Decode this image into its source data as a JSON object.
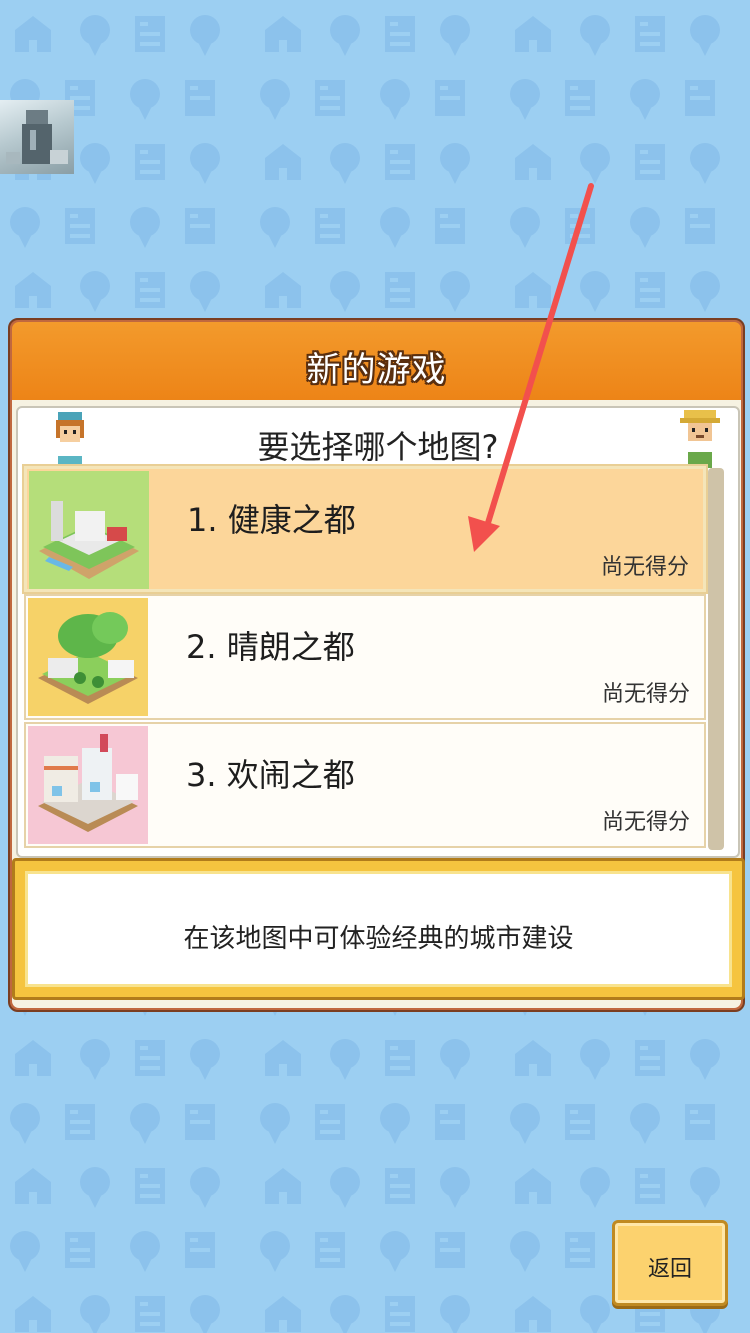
{
  "dialog": {
    "title": "新的游戏",
    "question": "要选择哪个地图?",
    "maps": [
      {
        "label": "1. 健康之都",
        "score": "尚无得分",
        "selected": true
      },
      {
        "label": "2. 晴朗之都",
        "score": "尚无得分",
        "selected": false
      },
      {
        "label": "3. 欢闹之都",
        "score": "尚无得分",
        "selected": false
      }
    ],
    "description": "在该地图中可体验经典的城市建设"
  },
  "footer": {
    "back_label": "返回"
  },
  "colors": {
    "background": "#9ccff2",
    "header_orange": "#ed8417",
    "selected_row": "#fcd69a",
    "arrow": "#f2504d"
  },
  "icons": [
    "house-icon",
    "balloon-icon",
    "building-icon"
  ]
}
